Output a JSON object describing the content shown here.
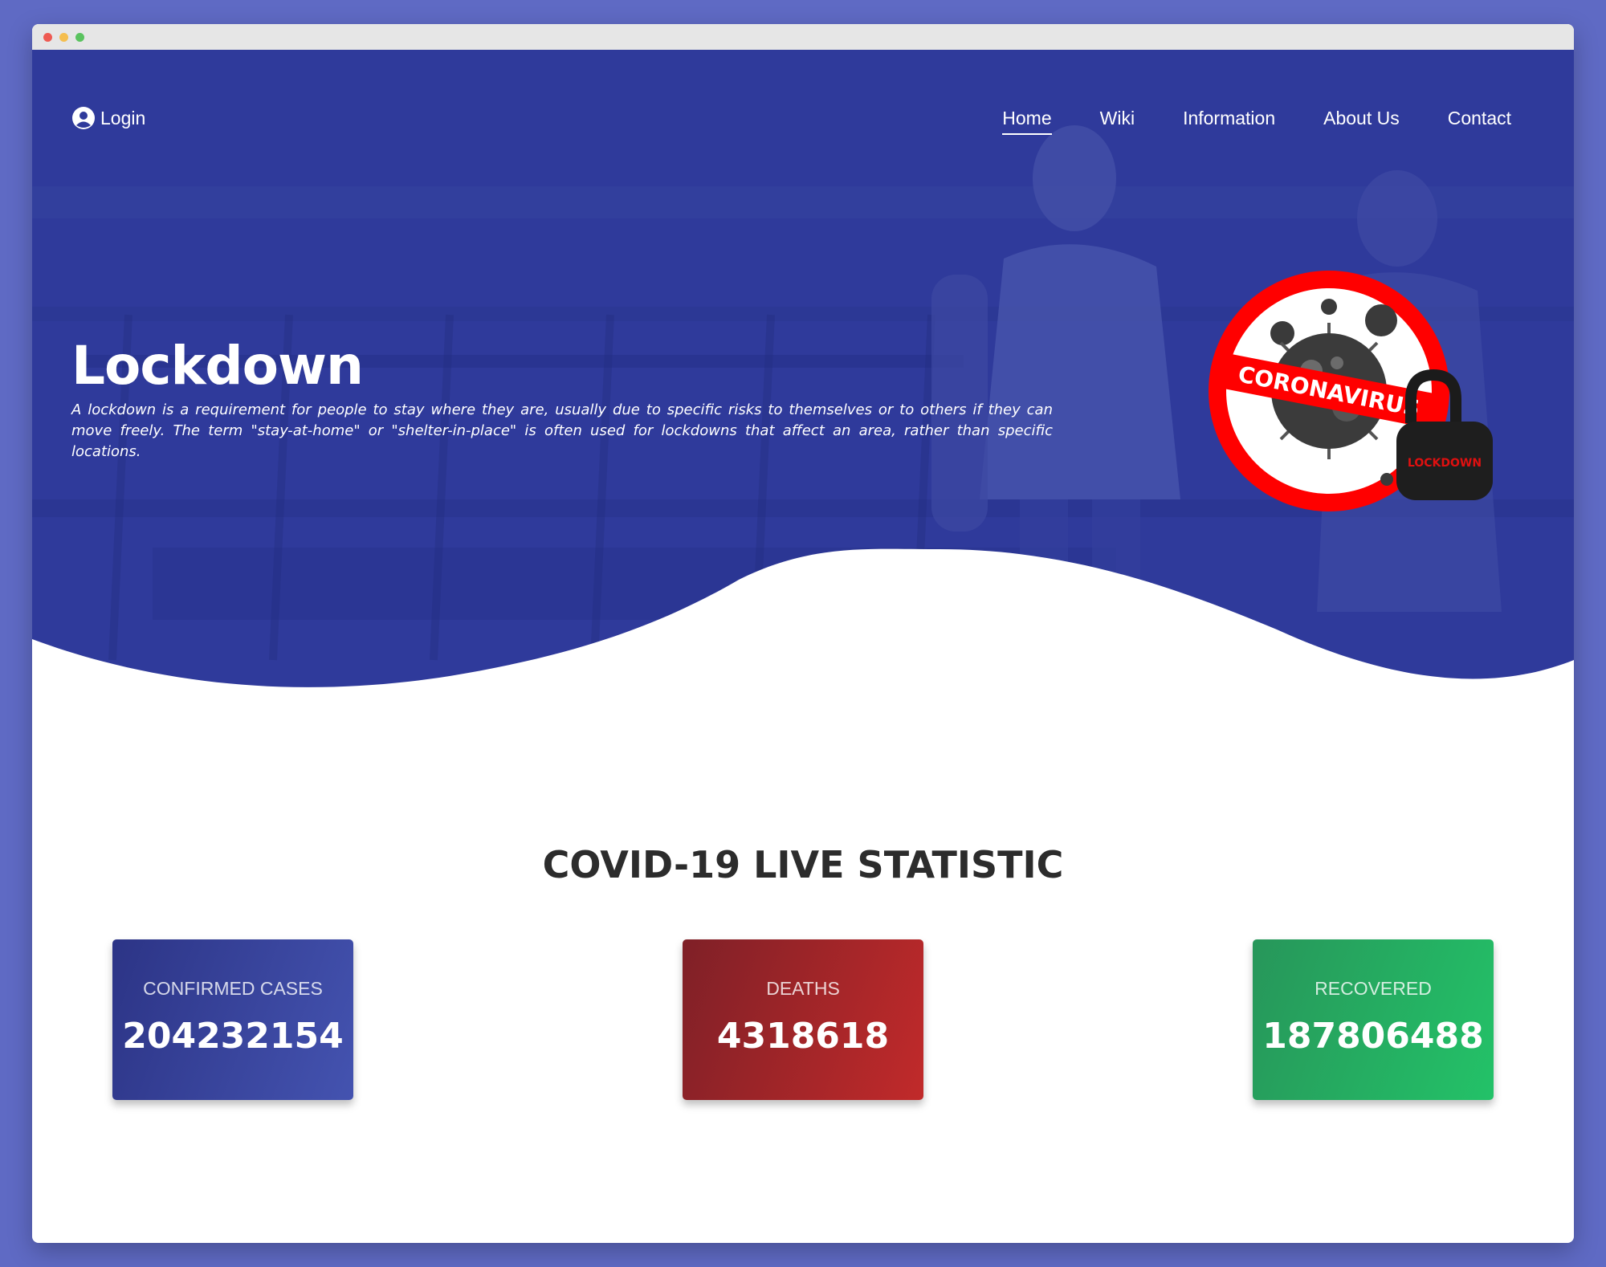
{
  "browser": {
    "controls": [
      "close",
      "minimize",
      "maximize"
    ]
  },
  "header": {
    "login_label": "Login",
    "login_icon": "user-circle-icon"
  },
  "nav": {
    "items": [
      {
        "label": "Home",
        "active": true
      },
      {
        "label": "Wiki",
        "active": false
      },
      {
        "label": "Information",
        "active": false
      },
      {
        "label": "About Us",
        "active": false
      },
      {
        "label": "Contact",
        "active": false
      }
    ]
  },
  "hero": {
    "title": "Lockdown",
    "description": "A lockdown is a requirement for people to stay where they are, usually due to specific risks to themselves or to others if they can move freely. The term \"stay-at-home\" or \"shelter-in-place\" is often used for lockdowns that affect an area, rather than specific locations.",
    "badge_text": "CORONAVIRUS",
    "lock_text": "LOCKDOWN"
  },
  "stats": {
    "title": "COVID-19 LIVE STATISTIC",
    "cards": [
      {
        "label": "CONFIRMED CASES",
        "value": "204232154",
        "color": "#3a449f"
      },
      {
        "label": "DEATHS",
        "value": "4318618",
        "color": "#a52428"
      },
      {
        "label": "RECOVERED",
        "value": "187806488",
        "color": "#26ad62"
      }
    ]
  },
  "colors": {
    "page_background": "#5f6ac4",
    "hero_overlay": "#2f3a9b",
    "title_text": "#2c2c2c",
    "badge_red": "#ff0000"
  }
}
